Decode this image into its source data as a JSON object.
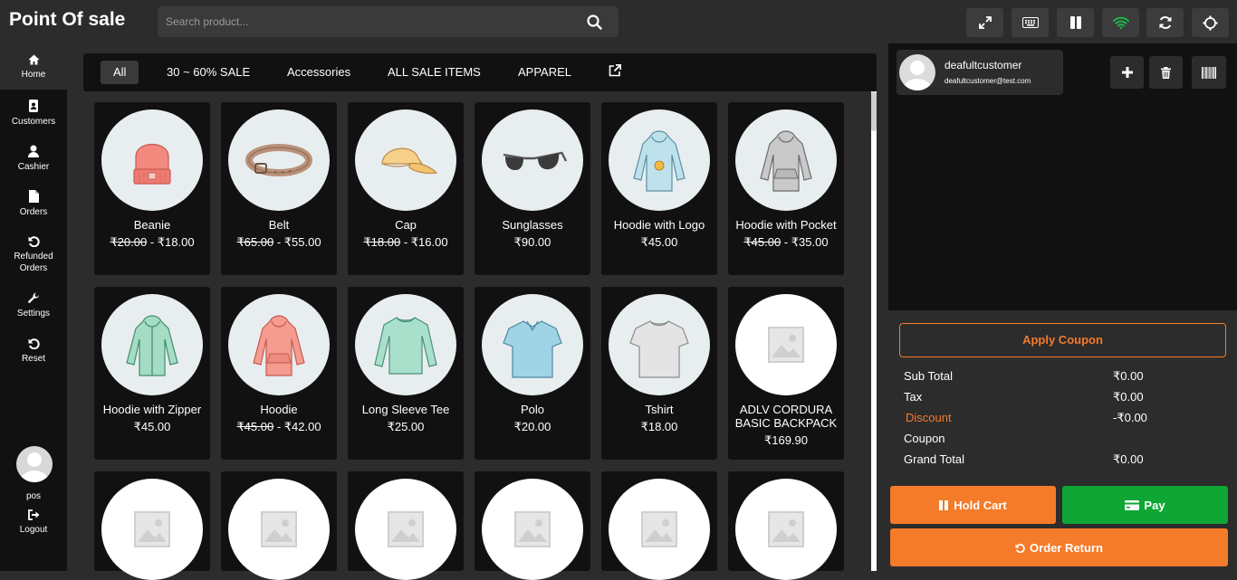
{
  "app": {
    "title": "Point Of sale"
  },
  "search": {
    "placeholder": "Search product..."
  },
  "toolbar_icons": [
    "expand-icon",
    "keyboard-icon",
    "pause-icon",
    "wifi-icon",
    "refresh-icon",
    "settings-icon"
  ],
  "colors": {
    "accent": "#f47b2a",
    "pay": "#0fa635",
    "wifi": "#1db44a",
    "panel": "#111111",
    "bg": "#2c2c2c"
  },
  "sidebar": {
    "items": [
      {
        "label": "Home",
        "icon": "home-icon"
      },
      {
        "label": "Customers",
        "icon": "address-book-icon"
      },
      {
        "label": "Cashier",
        "icon": "user-icon"
      },
      {
        "label": "Orders",
        "icon": "file-icon"
      },
      {
        "label": "Refunded Orders",
        "icon": "undo-icon"
      },
      {
        "label": "Settings",
        "icon": "wrench-icon"
      },
      {
        "label": "Reset",
        "icon": "undo-icon"
      }
    ],
    "user": "pos",
    "logout": "Logout"
  },
  "categories": [
    "All",
    "30 ~ 60% SALE",
    "Accessories",
    "ALL SALE ITEMS",
    "APPAREL"
  ],
  "products": [
    {
      "name": "Beanie",
      "old": "₹20.00",
      "price": "₹18.00"
    },
    {
      "name": "Belt",
      "old": "₹65.00",
      "price": "₹55.00"
    },
    {
      "name": "Cap",
      "old": "₹18.00",
      "price": "₹16.00"
    },
    {
      "name": "Sunglasses",
      "price": "₹90.00"
    },
    {
      "name": "Hoodie with Logo",
      "price": "₹45.00"
    },
    {
      "name": "Hoodie with Pocket",
      "old": "₹45.00",
      "price": "₹35.00"
    },
    {
      "name": "Hoodie with Zipper",
      "price": "₹45.00"
    },
    {
      "name": "Hoodie",
      "old": "₹45.00",
      "price": "₹42.00"
    },
    {
      "name": "Long Sleeve Tee",
      "price": "₹25.00"
    },
    {
      "name": "Polo",
      "price": "₹20.00"
    },
    {
      "name": "Tshirt",
      "price": "₹18.00"
    },
    {
      "name": "ADLV CORDURA BASIC BACKPACK",
      "price": "₹169.90"
    }
  ],
  "customer": {
    "name": "deafultcustomer",
    "email": "deafultcustomer@test.com"
  },
  "cart": {
    "apply_coupon": "Apply Coupon",
    "rows": [
      {
        "label": "Sub Total",
        "value": "₹0.00"
      },
      {
        "label": "Tax",
        "value": "₹0.00"
      },
      {
        "label": "Discount",
        "value": "-₹0.00"
      },
      {
        "label": "Coupon",
        "value": ""
      },
      {
        "label": "Grand Total",
        "value": "₹0.00"
      }
    ],
    "hold_cart": "Hold Cart",
    "pay": "Pay",
    "order_return": "Order Return"
  }
}
